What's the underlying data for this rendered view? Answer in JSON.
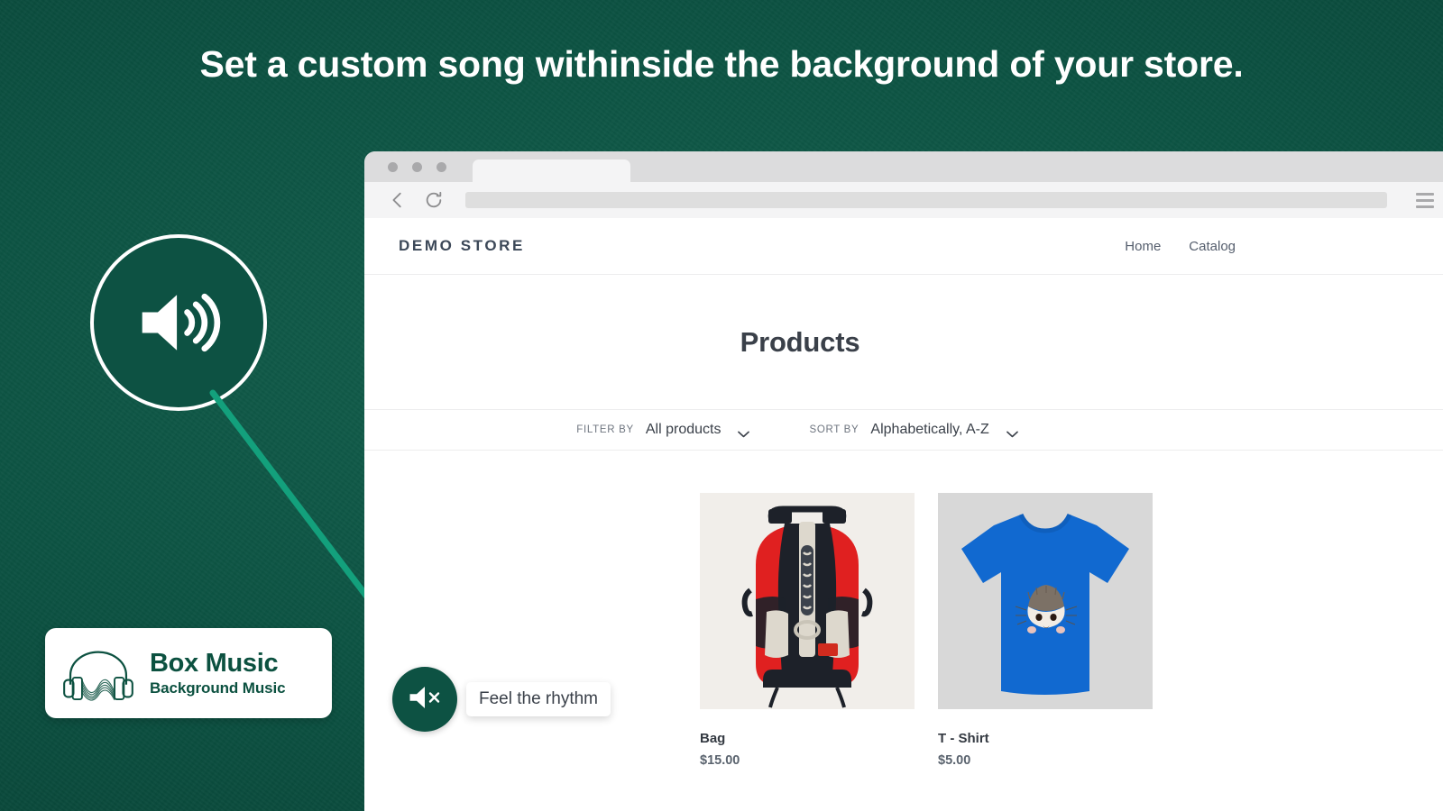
{
  "theme": {
    "background_green": "#0d5243",
    "arrow_green": "#13a07c",
    "brand_dark_green": "#0c5140",
    "store_text": "#3c4858"
  },
  "headline": {
    "text": "Set a custom song withinside the background of your store."
  },
  "speaker_badge": {
    "icon": "speaker-waves-icon"
  },
  "logo_card": {
    "icon": "headphones-waveform-icon",
    "title": "Box Music",
    "subtitle": "Background Music"
  },
  "annotation_arrow": {
    "icon": "arrow-down-right-icon"
  },
  "browser": {
    "window_dots": [
      "dot-red",
      "dot-yellow",
      "dot-green"
    ],
    "back_icon": "chevron-left-icon",
    "reload_icon": "reload-icon",
    "address_bar_value": "",
    "address_bar_placeholder": "",
    "menu_icon": "hamburger-menu-icon"
  },
  "store": {
    "logo": "DEMO STORE",
    "nav": [
      {
        "label": "Home"
      },
      {
        "label": "Catalog"
      }
    ],
    "page_title": "Products",
    "filter": {
      "label": "FILTER BY",
      "value": "All products",
      "caret_icon": "chevron-down-icon"
    },
    "sort": {
      "label": "SORT BY",
      "value": "Alphabetically, A-Z",
      "caret_icon": "chevron-down-icon"
    },
    "products": [
      {
        "name": "Bag",
        "price": "$15.00",
        "image": "red-black-backpack-photo"
      },
      {
        "name": "T - Shirt",
        "price": "$5.00",
        "image": "blue-hedgehog-tshirt-photo"
      }
    ]
  },
  "music_widget": {
    "icon": "speaker-muted-icon",
    "label": "Feel the rhythm"
  }
}
